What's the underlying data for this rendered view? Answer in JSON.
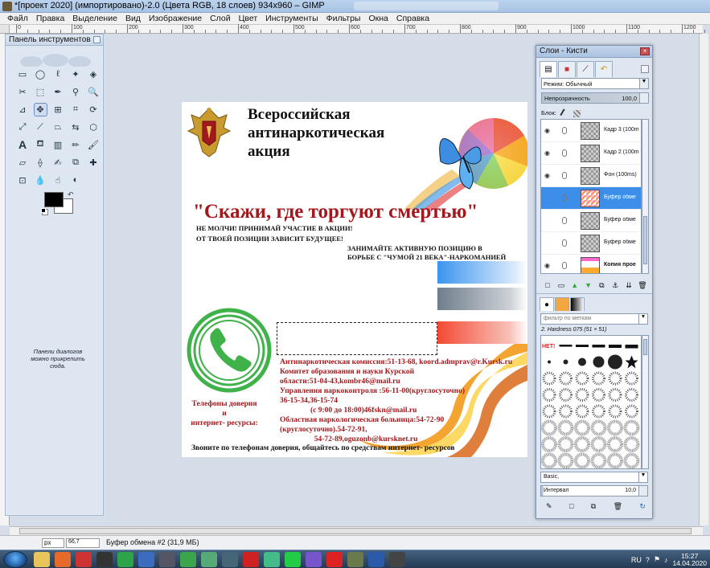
{
  "window": {
    "title": "*[проект 2020] (импортировано)-2.0 (Цвета RGB, 18 слоев) 934x960 – GIMP"
  },
  "menu": [
    "Файл",
    "Правка",
    "Выделение",
    "Вид",
    "Изображение",
    "Слой",
    "Цвет",
    "Инструменты",
    "Фильтры",
    "Окна",
    "Справка"
  ],
  "ruler": {
    "labels": [
      "|0",
      "|100",
      "|200",
      "|300",
      "|400",
      "|500",
      "|600",
      "|700",
      "|800",
      "|900",
      "|1000",
      "|1100",
      "|1200"
    ]
  },
  "toolbox": {
    "title": "Панель инструментов",
    "dock_hint": "Панели диалогов можно прикрепить сюда.",
    "tools": [
      "rect-select-icon",
      "ellipse-select-icon",
      "lasso-icon",
      "fuzzy-select-icon",
      "color-select-icon",
      "scissors-icon",
      "foreground-select-icon",
      "paths-icon",
      "color-picker-icon",
      "zoom-icon",
      "measure-icon",
      "move-icon",
      "align-icon",
      "crop-icon",
      "rotate-icon",
      "scale-icon",
      "shear-icon",
      "perspective-icon",
      "flip-icon",
      "cage-icon",
      "text-icon",
      "bucket-fill-icon",
      "blend-icon",
      "pencil-icon",
      "paintbrush-icon",
      "eraser-icon",
      "airbrush-icon",
      "ink-icon",
      "clone-icon",
      "heal-icon",
      "perspective-clone-icon",
      "blur-icon",
      "smudge-icon",
      "dodge-burn-icon"
    ],
    "foreground": "#000000",
    "background": "#ffffff"
  },
  "poster": {
    "heading": [
      "Всероссийская",
      "антинаркотическая",
      "акция"
    ],
    "slogan": "\"Скажи, где торгуют смертью\"",
    "line1": "НЕ МОЛЧИ! ПРИНИМАЙ УЧАСТИЕ В АКЦИИ!",
    "line2": "ОТ ТВОЕЙ ПОЗИЦИИ ЗАВИСИТ БУДУЩЕЕ!",
    "line3": "ЗАНИМАЙТЕ АКТИВНУЮ ПОЗИЦИЮ В",
    "line4": "БОРЬБЕ С \"ЧУМОЙ 21 ВЕКА\"-НАРКОМАНИЕЙ",
    "contacts": [
      "Антинаркотическая комиссия:51-13-68, koord.admprav@r.Kursk.ru",
      "Комитет образования и науки Курской",
      "области:51-04-43,kombr46@mail.ru",
      "Управления наркоконтроля :56-11-00(круглосуточно)",
      "36-15-34,36-15-74",
      "                (с 9:00 до 18:00)46fskn@mail.ru",
      "Областная наркологическая больница:54-72-90",
      "(круглосуточно).54-72-91,",
      "                  54-72-89,oguzonb@kursknet.ru"
    ],
    "phones_label": [
      "Телефоны доверия",
      "и",
      "интернет- ресурсы:"
    ],
    "footer": "Звоните по телефонам доверия, общайтесь по средствам интернет- ресурсов"
  },
  "layers_dock": {
    "title": "Слои - Кисти",
    "mode_label": "Режим:",
    "mode_value": "Обычный",
    "opacity_label": "Непрозрачность",
    "opacity_value": "100,0",
    "lock_label": "Блок:",
    "layers": [
      {
        "name": "Кадр 3 (100m",
        "visible": true,
        "selected": false,
        "bold": false
      },
      {
        "name": "Кадр 2 (100m",
        "visible": true,
        "selected": false,
        "bold": false
      },
      {
        "name": "Фон (100ms)",
        "visible": true,
        "selected": false,
        "bold": false
      },
      {
        "name": "Буфер обме",
        "visible": false,
        "selected": true,
        "bold": false
      },
      {
        "name": "Буфер обме",
        "visible": false,
        "selected": false,
        "bold": false
      },
      {
        "name": "Буфер обме",
        "visible": false,
        "selected": false,
        "bold": false
      },
      {
        "name": "Копия прое",
        "visible": true,
        "selected": false,
        "bold": true
      }
    ],
    "brush_filter_placeholder": "фильтр по меткам",
    "brush_name": "2. Hardness 075 (51 × 51)",
    "brush_preset": "Basic,",
    "spacing_label": "Интервал",
    "spacing_value": "10,0"
  },
  "statusbar": {
    "unit": "px",
    "zoom": "66,7",
    "message": "Буфер обмена #2 (31,9 МБ)"
  },
  "taskbar": {
    "language": "RU",
    "time": "15:27",
    "date": "14.04.2020"
  }
}
